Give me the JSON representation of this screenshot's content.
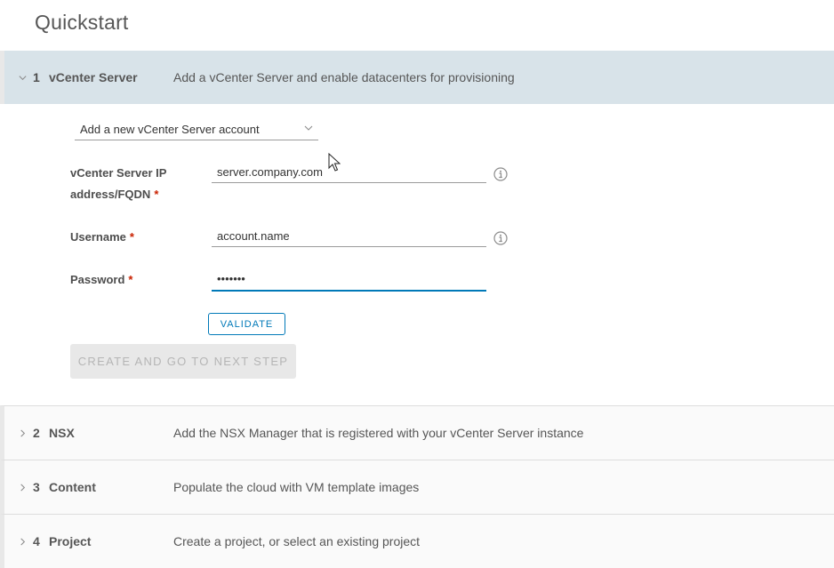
{
  "page": {
    "title": "Quickstart"
  },
  "steps": [
    {
      "number": "1",
      "title": "vCenter Server",
      "description": "Add a vCenter Server and enable datacenters for provisioning",
      "expanded": true
    },
    {
      "number": "2",
      "title": "NSX",
      "description": "Add the NSX Manager that is registered with your vCenter Server instance",
      "expanded": false
    },
    {
      "number": "3",
      "title": "Content",
      "description": "Populate the cloud with VM template images",
      "expanded": false
    },
    {
      "number": "4",
      "title": "Project",
      "description": "Create a project, or select an existing project",
      "expanded": false
    }
  ],
  "form": {
    "account_select": {
      "value": "Add a new vCenter Server account",
      "icon": "chevron-down-icon"
    },
    "server_field": {
      "label_line1": "vCenter Server IP",
      "label_line2": "address/FQDN",
      "required_mark": "*",
      "value": "server.company.com",
      "icon": "info-icon"
    },
    "username_field": {
      "label": "Username",
      "required_mark": "*",
      "value": "account.name",
      "icon": "info-icon"
    },
    "password_field": {
      "label": "Password",
      "required_mark": "*",
      "value": "•••••••",
      "focused": true
    },
    "validate_button": "VALIDATE",
    "create_button": {
      "label": "CREATE AND GO TO NEXT STEP",
      "disabled": true
    }
  },
  "colors": {
    "accent": "#0079b8",
    "required": "#c92100",
    "header_active_bg": "#d8e3e9",
    "disabled_bg": "#e8e8e8"
  }
}
